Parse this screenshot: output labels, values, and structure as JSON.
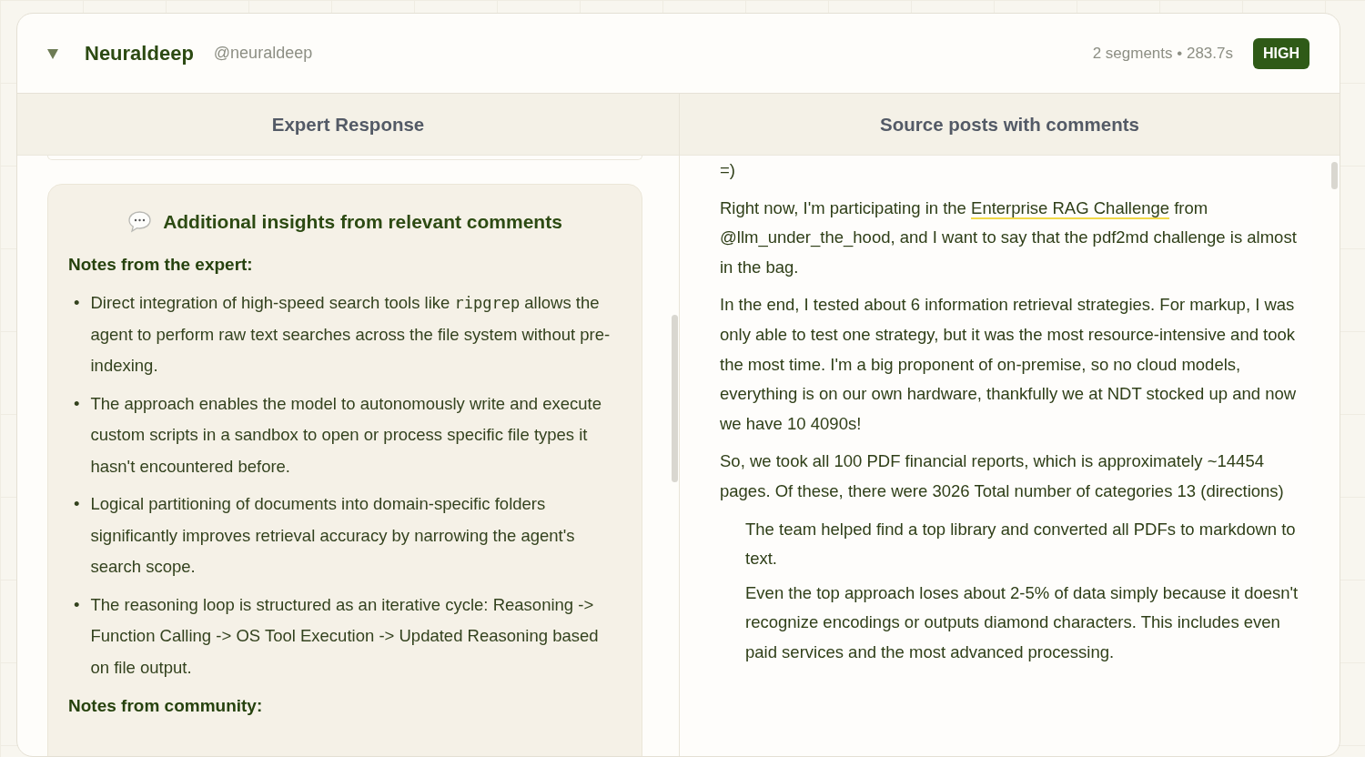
{
  "header": {
    "expanded": true,
    "title": "Neuraldeep",
    "handle": "@neuraldeep",
    "meta": "2 segments • 283.7s",
    "badge": "HIGH"
  },
  "columns": [
    {
      "title": "Expert Response"
    },
    {
      "title": "Source posts with comments"
    }
  ],
  "insights": {
    "title": "Additional insights from relevant comments",
    "sections": [
      {
        "heading": "Notes from the expert:",
        "bullets": [
          [
            {
              "kind": "marker",
              "text": "•"
            },
            {
              "kind": "text",
              "text": "Direct integration of high-speed search tools like "
            },
            {
              "kind": "code",
              "text": "ripgrep"
            },
            {
              "kind": "text",
              "text": " allows the agent to perform raw text searches across the file system without pre-indexing."
            }
          ],
          [
            {
              "kind": "marker",
              "text": "•"
            },
            {
              "kind": "text",
              "text": "The approach enables the model to autonomously write and execute custom scripts in a sandbox to open or process specific file types it hasn't encountered before."
            }
          ],
          [
            {
              "kind": "marker",
              "text": "•"
            },
            {
              "kind": "text",
              "text": "Logical partitioning of documents into domain-specific folders significantly improves retrieval accuracy by narrowing the agent's search scope."
            }
          ],
          [
            {
              "kind": "marker",
              "text": "•"
            },
            {
              "kind": "text",
              "text": "The reasoning loop is structured as an iterative cycle: Reasoning -> Function Calling -> OS Tool Execution -> Updated Reasoning based on file output."
            }
          ]
        ]
      },
      {
        "heading": "Notes from community:"
      }
    ]
  },
  "source": [
    {
      "kind": "text",
      "parts": [
        {
          "kind": "text",
          "text": "=)"
        }
      ]
    },
    {
      "kind": "text",
      "parts": [
        {
          "kind": "text",
          "text": "Right now, I'm participating in the "
        },
        {
          "kind": "link",
          "text": "Enterprise RAG Challenge"
        },
        {
          "kind": "text",
          "text": " from @llm_under_the_hood, and I want to say that the pdf2md challenge is almost in the bag."
        }
      ]
    },
    {
      "kind": "text",
      "parts": [
        {
          "kind": "text",
          "text": "In the end, I tested about 6 information retrieval strategies. For markup, I was only able to test one strategy, but it was the most resource-intensive and took the most time. I'm a big proponent of on-premise, so no cloud models, everything is on our own hardware, thankfully we at NDT stocked up and now we have 10 4090s!"
        }
      ]
    },
    {
      "kind": "text",
      "parts": [
        {
          "kind": "text",
          "text": "So, we took all 100 PDF financial reports, which is approximately ~14454 pages. Of these, there were 3026 Total number of categories 13 (directions)"
        }
      ]
    },
    {
      "kind": "quote",
      "parts": [
        {
          "kind": "text",
          "text": "The team helped find a top library and converted all PDFs to markdown to text."
        }
      ]
    },
    {
      "kind": "quote",
      "parts": [
        {
          "kind": "text",
          "text": "Even the top approach loses about 2-5% of data simply because it doesn't recognize encodings or outputs diamond characters. This includes even paid services and the most advanced processing."
        }
      ]
    }
  ]
}
